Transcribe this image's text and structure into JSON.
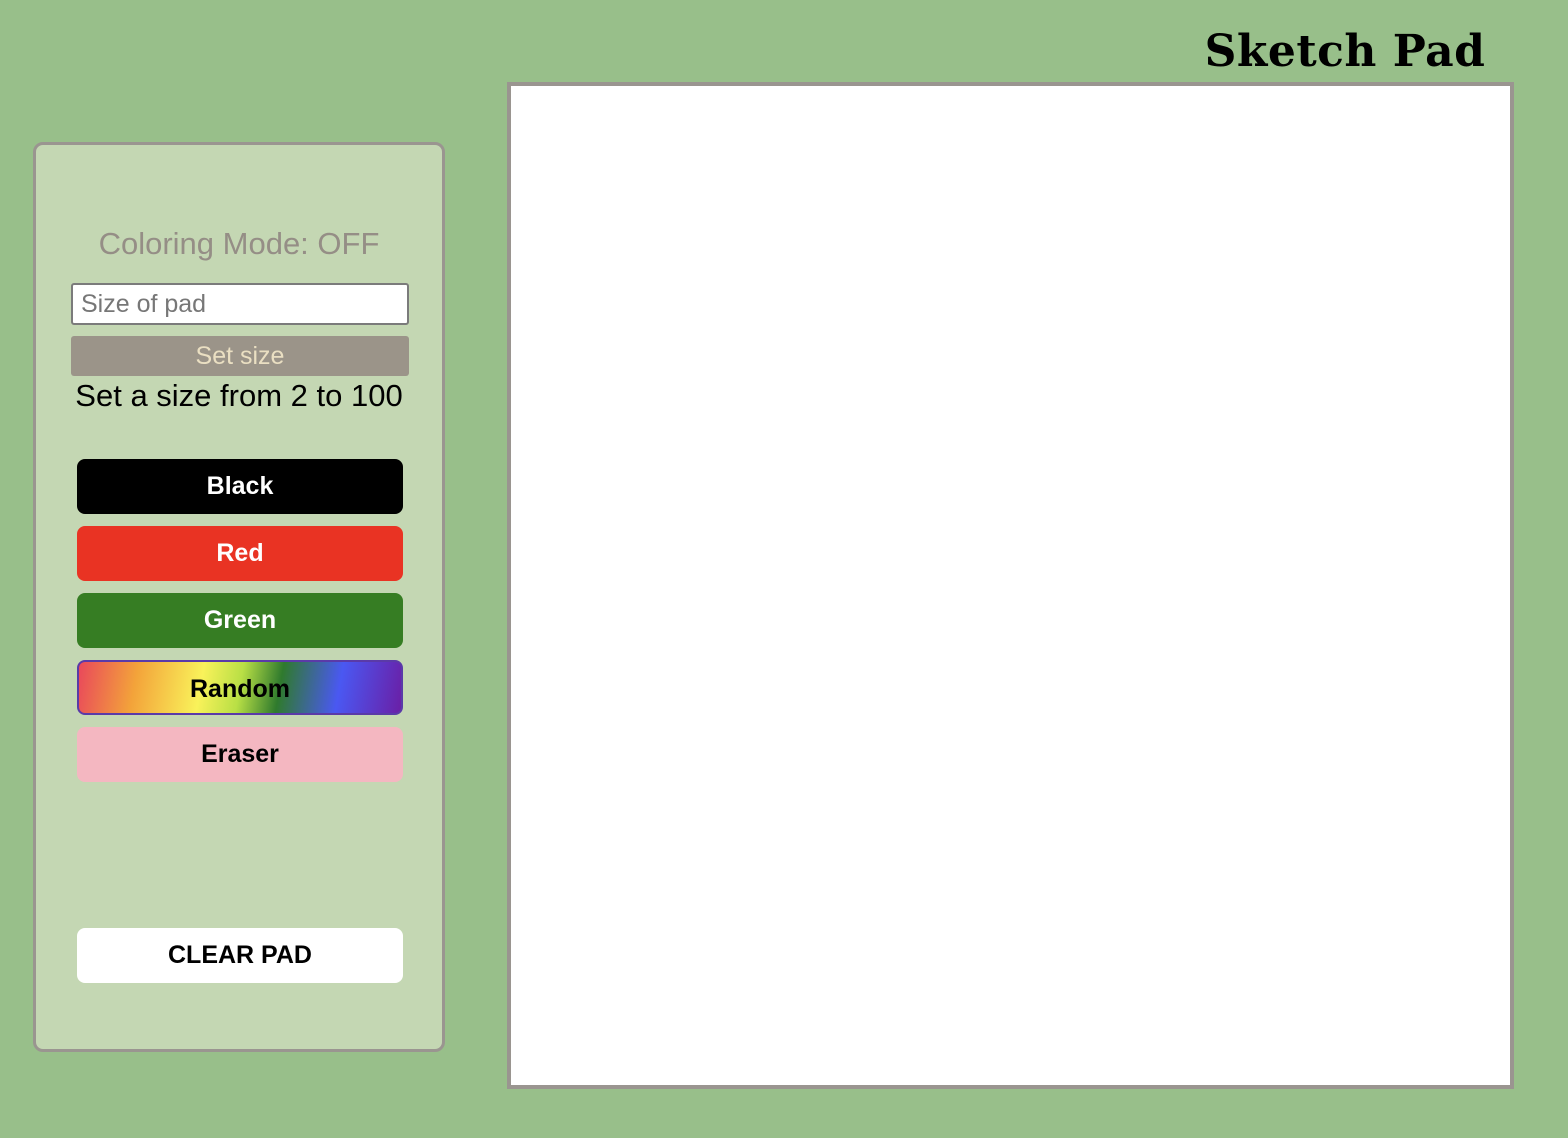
{
  "header": {
    "title": "Sketch Pad"
  },
  "controls": {
    "mode_status": "Coloring Mode: OFF",
    "size_input": {
      "placeholder": "Size of pad",
      "value": ""
    },
    "set_size_label": "Set size",
    "size_hint": "Set a size from 2 to 100"
  },
  "colors": [
    {
      "label": "Black",
      "bg": "#000000",
      "fg": "#ffffff"
    },
    {
      "label": "Red",
      "bg": "#e93323",
      "fg": "#ffffff"
    },
    {
      "label": "Green",
      "bg": "#367d23",
      "fg": "#ffffff"
    },
    {
      "label": "Random",
      "bg": "rainbow-gradient",
      "fg": "#000000"
    },
    {
      "label": "Eraser",
      "bg": "#f4b7c1",
      "fg": "#000000"
    }
  ],
  "clear_label": "CLEAR PAD",
  "theme": {
    "page_bg": "#98bf8a",
    "panel_bg": "#c4d7b3",
    "border": "#9a9590",
    "pad_bg": "#ffffff"
  }
}
